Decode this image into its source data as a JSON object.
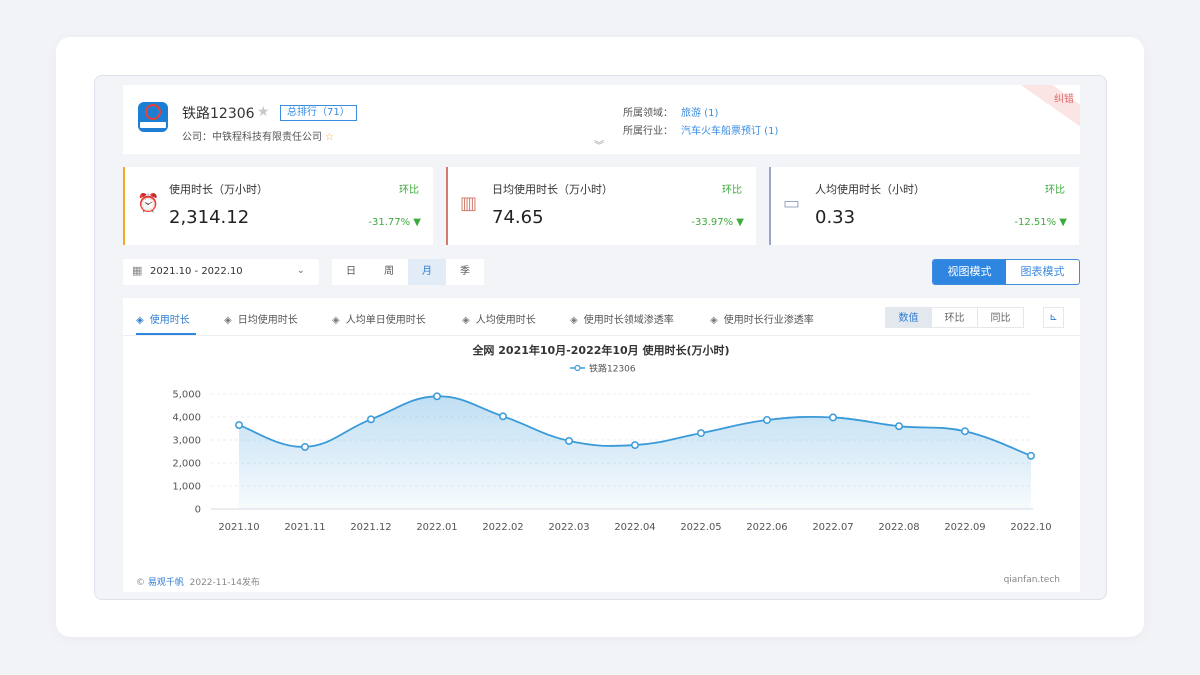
{
  "app": {
    "name": "铁路12306",
    "rank_badge": "总排行（71）",
    "company": "公司：中铁程科技有限责任公司",
    "domain_label": "所属领域：",
    "domain_value": "旅游 (1)",
    "industry_label": "所属行业：",
    "industry_value": "汽车火车船票预订 (1)",
    "corner_tag": "纠错"
  },
  "kpis": [
    {
      "title": "使用时长（万小时）",
      "value": "2,314.12",
      "compare_label": "环比",
      "change": "-31.77%",
      "color": "#f5a623",
      "icon": "clock-icon"
    },
    {
      "title": "日均使用时长（万小时）",
      "value": "74.65",
      "compare_label": "环比",
      "change": "-33.97%",
      "color": "#d27b6c",
      "icon": "calendar-icon"
    },
    {
      "title": "人均使用时长（小时）",
      "value": "0.33",
      "compare_label": "环比",
      "change": "-12.51%",
      "color": "#9aa3c8",
      "icon": "monitor-icon"
    }
  ],
  "toolbar": {
    "date_range": "2021.10 - 2022.10",
    "periods": [
      "日",
      "周",
      "月",
      "季"
    ],
    "active_period": "月",
    "modes": [
      "视图模式",
      "图表模式"
    ],
    "active_mode": "视图模式"
  },
  "tabs": [
    "使用时长",
    "日均使用时长",
    "人均单日使用时长",
    "人均使用时长",
    "使用时长领域渗透率",
    "使用时长行业渗透率"
  ],
  "metric_buttons": [
    "数值",
    "环比",
    "同比"
  ],
  "chart_data": {
    "type": "line",
    "title": "全网 2021年10月-2022年10月 使用时长(万小时)",
    "categories": [
      "2021.10",
      "2021.11",
      "2021.12",
      "2022.01",
      "2022.02",
      "2022.03",
      "2022.04",
      "2022.05",
      "2022.06",
      "2022.07",
      "2022.08",
      "2022.09",
      "2022.10"
    ],
    "series": [
      {
        "name": "铁路12306",
        "values": [
          3650,
          2700,
          3900,
          4900,
          4030,
          2960,
          2780,
          3300,
          3870,
          3980,
          3600,
          3380,
          2314
        ],
        "color": "#3a9ad9"
      }
    ],
    "ylim": [
      0,
      5000
    ],
    "yticks": [
      "0",
      "1,000",
      "2,000",
      "3,000",
      "4,000",
      "5,000"
    ],
    "grid": true,
    "legend": "top-center",
    "area": true
  },
  "footer": {
    "copyright": "© ",
    "brand": "易观千帆",
    "published": "2022-11-14发布",
    "site": "qianfan.tech"
  }
}
